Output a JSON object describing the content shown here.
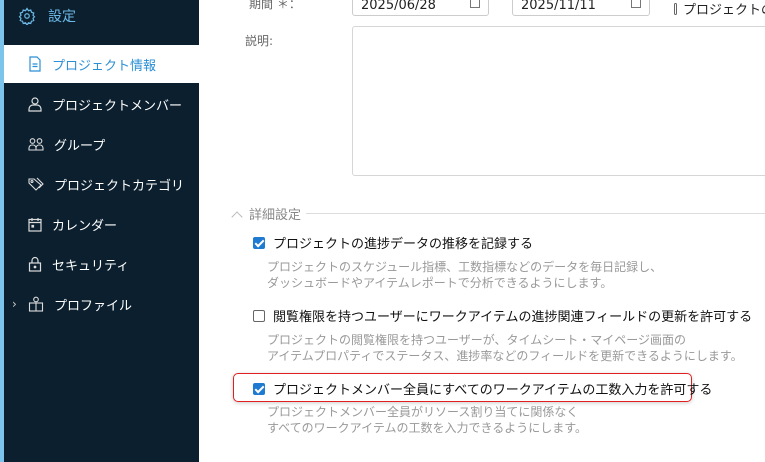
{
  "sidebar": {
    "title": "設定",
    "items": [
      {
        "label": "プロジェクト情報",
        "icon": "document-icon",
        "active": true
      },
      {
        "label": "プロジェクトメンバー",
        "icon": "user-icon"
      },
      {
        "label": "グループ",
        "icon": "users-icon"
      },
      {
        "label": "プロジェクトカテゴリ",
        "icon": "tag-icon"
      },
      {
        "label": "カレンダー",
        "icon": "calendar-icon"
      },
      {
        "label": "セキュリティ",
        "icon": "lock-icon"
      },
      {
        "label": "プロファイル",
        "icon": "profile-icon",
        "expandable": true
      }
    ]
  },
  "form": {
    "period_label": "期間 ＊：",
    "start_date": "2025/06/28",
    "end_date": "2025/11/11",
    "right_checkbox_label": "プロジェクトの",
    "description_label": "説明:",
    "description_value": ""
  },
  "advanced": {
    "title": "詳細設定",
    "options": [
      {
        "label": "プロジェクトの進捗データの推移を記録する",
        "checked": true,
        "desc": [
          "プロジェクトのスケジュール指標、工数指標などのデータを毎日記録し、",
          "ダッシュボードやアイテムレポートで分析できるようにします。"
        ]
      },
      {
        "label": "閲覧権限を持つユーザーにワークアイテムの進捗関連フィールドの更新を許可する",
        "checked": false,
        "desc": [
          "プロジェクトの閲覧権限を持つユーザーが、タイムシート・マイページ画面の",
          "アイテムプロパティでステータス、進捗率などのフィールドを更新できるようにします。"
        ]
      },
      {
        "label": "プロジェクトメンバー全員にすべてのワークアイテムの工数入力を許可する",
        "checked": true,
        "highlighted": true,
        "desc": [
          "プロジェクトメンバー全員がリソース割り当てに関係なく",
          "すべてのワークアイテムの工数を入力できるようにします。"
        ]
      }
    ]
  },
  "colors": {
    "sidebar_bg": "#0b1f2e",
    "accent": "#1f7ad1",
    "highlight": "#e02020"
  }
}
